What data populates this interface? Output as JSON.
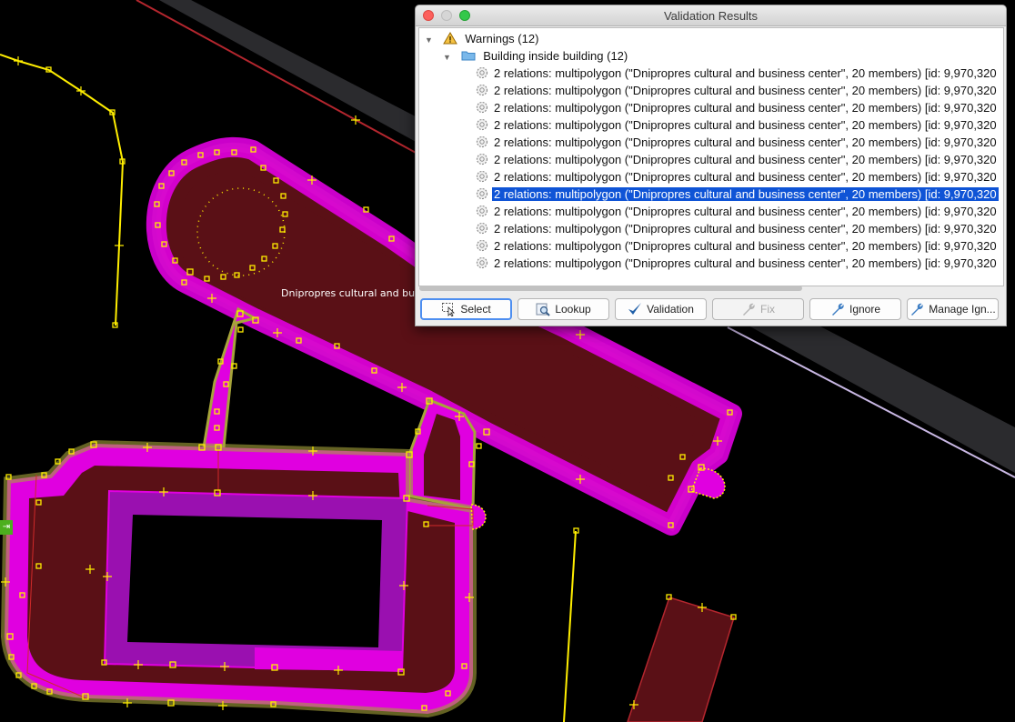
{
  "window": {
    "title": "Validation Results"
  },
  "tree": {
    "warnings_label": "Warnings (12)",
    "group_label": "Building inside building (12)",
    "items": [
      "2 relations: multipolygon (\"Dnipropres cultural and business center\", 20 members) [id: 9,970,320",
      "2 relations: multipolygon (\"Dnipropres cultural and business center\", 20 members) [id: 9,970,320",
      "2 relations: multipolygon (\"Dnipropres cultural and business center\", 20 members) [id: 9,970,320",
      "2 relations: multipolygon (\"Dnipropres cultural and business center\", 20 members) [id: 9,970,320",
      "2 relations: multipolygon (\"Dnipropres cultural and business center\", 20 members) [id: 9,970,320",
      "2 relations: multipolygon (\"Dnipropres cultural and business center\", 20 members) [id: 9,970,320",
      "2 relations: multipolygon (\"Dnipropres cultural and business center\", 20 members) [id: 9,970,320",
      "2 relations: multipolygon (\"Dnipropres cultural and business center\", 20 members) [id: 9,970,320",
      "2 relations: multipolygon (\"Dnipropres cultural and business center\", 20 members) [id: 9,970,320",
      "2 relations: multipolygon (\"Dnipropres cultural and business center\", 20 members) [id: 9,970,320",
      "2 relations: multipolygon (\"Dnipropres cultural and business center\", 20 members) [id: 9,970,320",
      "2 relations: multipolygon (\"Dnipropres cultural and business center\", 20 members) [id: 9,970,320"
    ],
    "selected_index": 7
  },
  "buttons": {
    "select": "Select",
    "lookup": "Lookup",
    "validation": "Validation",
    "fix": "Fix",
    "ignore": "Ignore",
    "manage_ignore": "Manage Ign..."
  },
  "map": {
    "feature_label": "Dnipropres cultural and business center",
    "edge_tag": "⇥"
  },
  "colors": {
    "selection": "#0f54d6",
    "building_fill": "#5a1016",
    "highlight": "#e000e0",
    "way_yellow": "#ffee00"
  },
  "icons": {
    "warnings": "warning-triangle-icon",
    "group": "folder-icon",
    "item": "gear-icon"
  }
}
